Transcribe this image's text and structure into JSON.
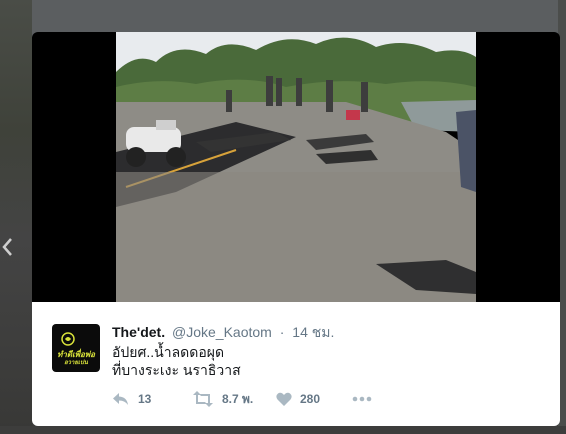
{
  "tweet": {
    "display_name": "The'det.",
    "handle": "@Joke_Kaotom",
    "separator": "·",
    "timestamp": "14 ชม.",
    "text_lines": [
      "อัปยศ..น้ำลดดอผุด",
      "ที่บางระเงะ นราธิวาส"
    ],
    "avatar_text": [
      "ทำดีเพื่อพ่อ",
      "อวายเปน"
    ],
    "counts": {
      "replies": "13",
      "retweets": "8.7 พ.",
      "likes": "280"
    }
  },
  "icons": {
    "prev": "chevron-left-icon",
    "reply": "reply-icon",
    "retweet": "retweet-icon",
    "like": "heart-icon",
    "more": "more-icon"
  },
  "colors": {
    "card_bg": "#ffffff",
    "secondary_text": "#657786",
    "primary_text": "#14171a",
    "avatar_accent": "#d8e13a",
    "icon_gray": "#aab8c2"
  }
}
